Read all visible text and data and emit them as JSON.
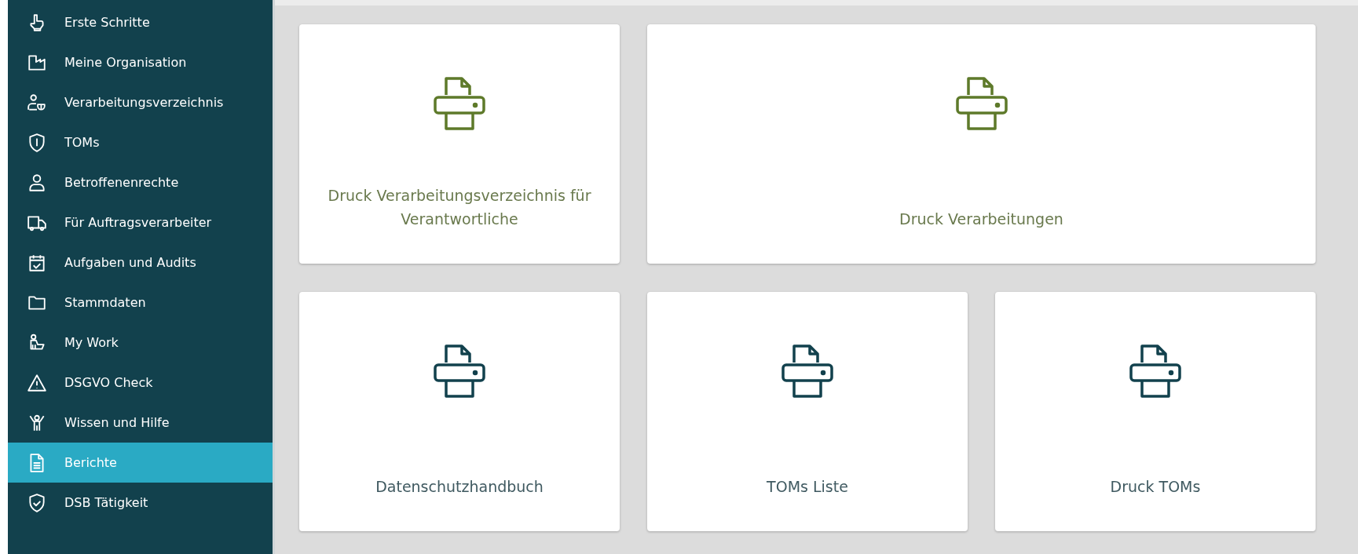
{
  "sidebar": {
    "items": [
      {
        "label": "Erste Schritte",
        "selected": false
      },
      {
        "label": "Meine Organisation",
        "selected": false
      },
      {
        "label": "Verarbeitungsverzeichnis",
        "selected": false
      },
      {
        "label": "TOMs",
        "selected": false
      },
      {
        "label": "Betroffenenrechte",
        "selected": false
      },
      {
        "label": "Für Auftragsverarbeiter",
        "selected": false
      },
      {
        "label": "Aufgaben und Audits",
        "selected": false
      },
      {
        "label": "Stammdaten",
        "selected": false
      },
      {
        "label": "My Work",
        "selected": false
      },
      {
        "label": "DSGVO Check",
        "selected": false
      },
      {
        "label": "Wissen und Hilfe",
        "selected": false
      },
      {
        "label": "Berichte",
        "selected": true
      },
      {
        "label": "DSB Tätigkeit",
        "selected": false
      }
    ]
  },
  "report_rows": [
    [
      {
        "title": "Druck Verarbeitungsverzeichnis für Verantwortliche",
        "color": "#5e7a2a"
      },
      {
        "title": "Druck Verarbeitungen",
        "color": "#5e7a2a"
      }
    ],
    [
      {
        "title": "Datenschutzhandbuch",
        "color": "#12414d"
      },
      {
        "title": "TOMs Liste",
        "color": "#12414d"
      },
      {
        "title": "Druck TOMs",
        "color": "#12414d"
      }
    ]
  ]
}
